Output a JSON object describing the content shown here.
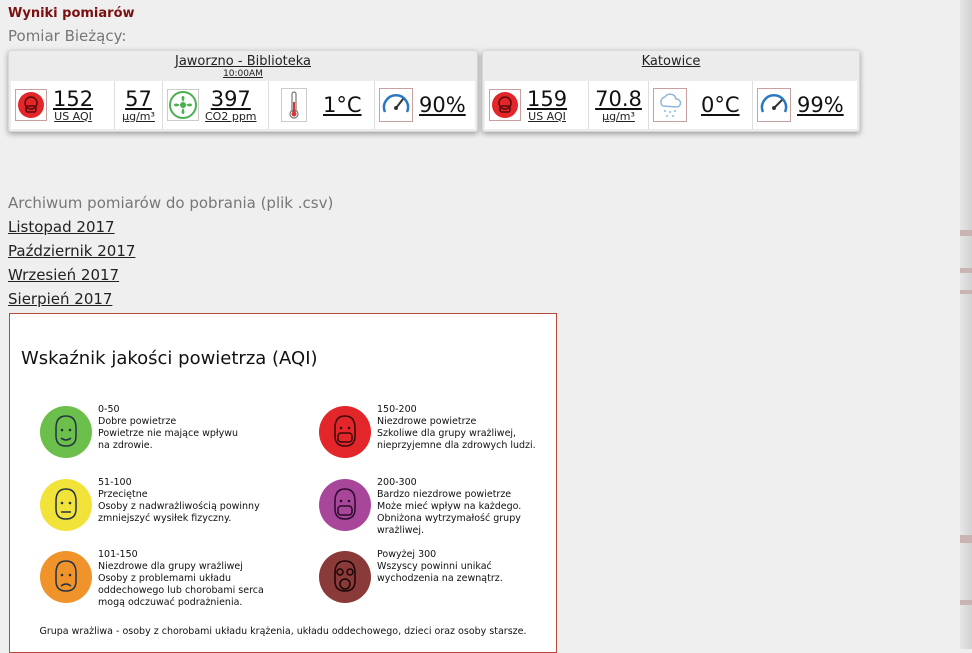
{
  "header": {
    "title": "Wyniki pomiarów",
    "current_label": "Pomiar Bieżący:"
  },
  "stations": [
    {
      "name": "Jaworzno - Biblioteka",
      "time": "10:00AM",
      "aqi": "152",
      "aqi_unit": "US AQI",
      "pm": "57",
      "pm_unit": "µg/m³",
      "co2": "397",
      "co2_unit": "CO2 ppm",
      "temp": "1°C",
      "humidity": "90%"
    },
    {
      "name": "Katowice",
      "aqi": "159",
      "aqi_unit": "US AQI",
      "pm": "70.8",
      "pm_unit": "µg/m³",
      "temp": "0°C",
      "humidity": "99%"
    }
  ],
  "archive": {
    "title": "Archiwum pomiarów do pobrania (plik .csv)",
    "links": [
      "Listopad 2017",
      "Październik 2017",
      "Wrzesień 2017",
      "Sierpień 2017"
    ]
  },
  "aqi_legend": {
    "title": "Wskaźnik jakości powietrza (AQI)",
    "items": [
      {
        "range": "0-50",
        "label": "Dobre powietrze",
        "desc": [
          "Powietrze nie mające wpływu",
          "na zdrowie."
        ],
        "color": "#6cbf4a",
        "face": "smile"
      },
      {
        "range": "51-100",
        "label": "Przeciętne",
        "desc": [
          "Osoby z nadwrażliwością powinny",
          "zmniejszyć wysiłek fizyczny."
        ],
        "color": "#f2e33a",
        "face": "neutral"
      },
      {
        "range": "101-150",
        "label": "Niezdrowe dla grupy wrażliwej",
        "desc": [
          "Osoby z problemami układu",
          "oddechowego lub chorobami serca",
          "mogą odczuwać podrażnienia."
        ],
        "color": "#f0932b",
        "face": "sad"
      },
      {
        "range": "150-200",
        "label": "Niezdrowe powietrze",
        "desc": [
          "Szkoliwe dla grupy wrażliwej,",
          "nieprzyjemne dla zdrowych ludzi."
        ],
        "color": "#e2262a",
        "face": "mask"
      },
      {
        "range": "200-300",
        "label": "Bardzo niezdrowe powietrze",
        "desc": [
          "Może mieć wpływ na każdego.",
          "Obniżona wytrzymałość grupy",
          "wrażliwej."
        ],
        "color": "#a8479a",
        "face": "mask"
      },
      {
        "range": "Powyżej 300",
        "label": "Wszyscy powinni unikać",
        "desc": [
          "wychodzenia na zewnątrz."
        ],
        "color": "#8b3a3a",
        "face": "gasmask"
      }
    ],
    "footer": "Grupa wrażliwa - osoby z chorobami układu krążenia, układu oddechowego, dzieci oraz osoby starsze."
  },
  "colors": {
    "heading": "#7a1010",
    "aqi_badge": "#e2262a",
    "fan": "#4caf50",
    "gauge": "#2b78c2"
  },
  "icons": [
    "mask-face-icon",
    "fan-icon",
    "thermometer-icon",
    "humidity-gauge-icon",
    "cloud-snow-icon"
  ]
}
